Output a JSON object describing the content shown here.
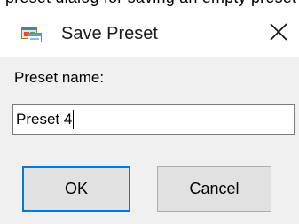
{
  "partial_top_text": "preset dialog for saving an empty preset",
  "window": {
    "title": "Save Preset",
    "icon": "application-window-icon",
    "close_icon": "close-icon"
  },
  "form": {
    "label": "Preset name:",
    "input_value": "Preset 4"
  },
  "buttons": {
    "ok_label": "OK",
    "cancel_label": "Cancel"
  }
}
